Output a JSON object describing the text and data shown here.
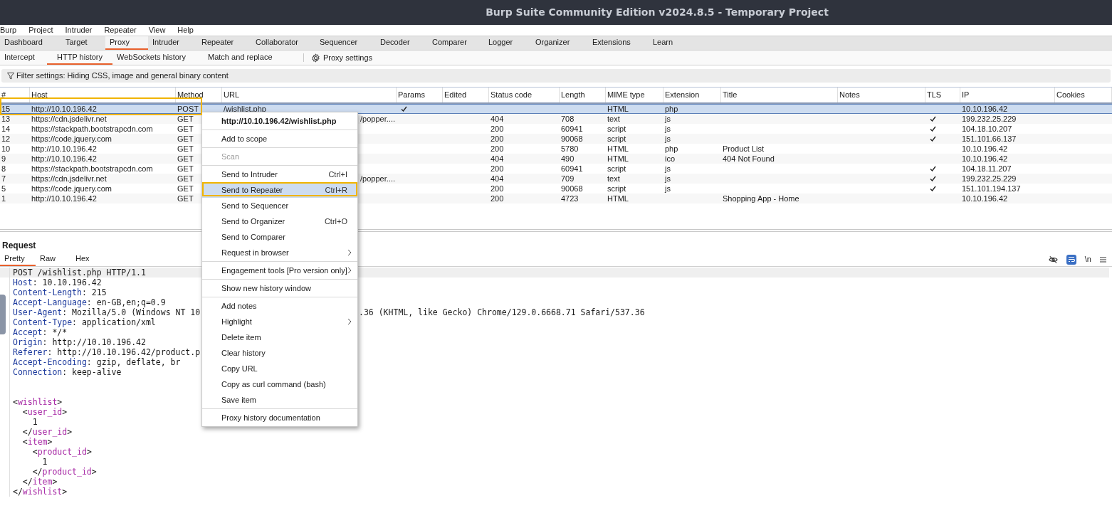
{
  "window": {
    "title": "Burp Suite Community Edition v2024.8.5 - Temporary Project"
  },
  "menu_bar": [
    "Burp",
    "Project",
    "Intruder",
    "Repeater",
    "View",
    "Help"
  ],
  "tabs": [
    {
      "label": "Dashboard",
      "selected": false
    },
    {
      "label": "Target",
      "selected": false
    },
    {
      "label": "Proxy",
      "selected": true
    },
    {
      "label": "Intruder",
      "selected": false
    },
    {
      "label": "Repeater",
      "selected": false
    },
    {
      "label": "Collaborator",
      "selected": false
    },
    {
      "label": "Sequencer",
      "selected": false
    },
    {
      "label": "Decoder",
      "selected": false
    },
    {
      "label": "Comparer",
      "selected": false
    },
    {
      "label": "Logger",
      "selected": false
    },
    {
      "label": "Organizer",
      "selected": false
    },
    {
      "label": "Extensions",
      "selected": false
    },
    {
      "label": "Learn",
      "selected": false
    }
  ],
  "sub_tabs": [
    {
      "label": "Intercept",
      "selected": false
    },
    {
      "label": "HTTP history",
      "selected": true
    },
    {
      "label": "WebSockets history",
      "selected": false
    },
    {
      "label": "Match and replace",
      "selected": false
    }
  ],
  "proxy_settings": "Proxy settings",
  "filter": "Filter settings: Hiding CSS, image and general binary content",
  "table": {
    "columns": [
      "#",
      "Host",
      "Method",
      "URL",
      "Params",
      "Edited",
      "Status code",
      "Length",
      "MIME type",
      "Extension",
      "Title",
      "Notes",
      "TLS",
      "IP",
      "Cookies"
    ],
    "rows": [
      {
        "num": "15",
        "host": "http://10.10.196.42",
        "method": "POST",
        "url": "/wishlist.php",
        "params": true,
        "status": "",
        "length": "",
        "mime": "HTML",
        "ext": "php",
        "title": "",
        "tls": false,
        "ip": "10.10.196.42",
        "selected": true
      },
      {
        "num": "13",
        "host": "https://cdn.jsdelivr.net",
        "method": "GET",
        "url_tail": "/popper....",
        "params": false,
        "status": "404",
        "length": "708",
        "mime": "text",
        "ext": "js",
        "title": "",
        "tls": true,
        "ip": "199.232.25.229",
        "selected": false
      },
      {
        "num": "14",
        "host": "https://stackpath.bootstrapcdn.com",
        "method": "GET",
        "params": false,
        "status": "200",
        "length": "60941",
        "mime": "script",
        "ext": "js",
        "title": "",
        "tls": true,
        "ip": "104.18.10.207",
        "selected": false
      },
      {
        "num": "12",
        "host": "https://code.jquery.com",
        "method": "GET",
        "params": false,
        "status": "200",
        "length": "90068",
        "mime": "script",
        "ext": "js",
        "title": "",
        "tls": true,
        "ip": "151.101.66.137",
        "selected": false
      },
      {
        "num": "10",
        "host": "http://10.10.196.42",
        "method": "GET",
        "params": false,
        "status": "200",
        "length": "5780",
        "mime": "HTML",
        "ext": "php",
        "title": "Product List",
        "tls": false,
        "ip": "10.10.196.42",
        "selected": false
      },
      {
        "num": "9",
        "host": "http://10.10.196.42",
        "method": "GET",
        "params": false,
        "status": "404",
        "length": "490",
        "mime": "HTML",
        "ext": "ico",
        "title": "404 Not Found",
        "tls": false,
        "ip": "10.10.196.42",
        "selected": false
      },
      {
        "num": "8",
        "host": "https://stackpath.bootstrapcdn.com",
        "method": "GET",
        "params": false,
        "status": "200",
        "length": "60941",
        "mime": "script",
        "ext": "js",
        "title": "",
        "tls": true,
        "ip": "104.18.11.207",
        "selected": false
      },
      {
        "num": "7",
        "host": "https://cdn.jsdelivr.net",
        "method": "GET",
        "url_tail": "/popper....",
        "params": false,
        "status": "404",
        "length": "709",
        "mime": "text",
        "ext": "js",
        "title": "",
        "tls": true,
        "ip": "199.232.25.229",
        "selected": false
      },
      {
        "num": "5",
        "host": "https://code.jquery.com",
        "method": "GET",
        "params": false,
        "status": "200",
        "length": "90068",
        "mime": "script",
        "ext": "js",
        "title": "",
        "tls": true,
        "ip": "151.101.194.137",
        "selected": false
      },
      {
        "num": "1",
        "host": "http://10.10.196.42",
        "method": "GET",
        "params": false,
        "status": "200",
        "length": "4723",
        "mime": "HTML",
        "ext": "",
        "title": "Shopping App - Home",
        "tls": false,
        "ip": "10.10.196.42",
        "selected": false
      }
    ]
  },
  "request": {
    "heading": "Request",
    "tabs": [
      {
        "label": "Pretty",
        "selected": true
      },
      {
        "label": "Raw",
        "selected": false
      },
      {
        "label": "Hex",
        "selected": false
      }
    ],
    "newline_toggle": "\\n",
    "wrap_on": true,
    "lines": [
      {
        "kind": "plain",
        "text": "POST /wishlist.php HTTP/1.1"
      },
      {
        "kind": "header",
        "name": "Host",
        "value": ": 10.10.196.42"
      },
      {
        "kind": "header",
        "name": "Content-Length",
        "value": ": 215"
      },
      {
        "kind": "header",
        "name": "Accept-Language",
        "value": ": en-GB,en;q=0.9"
      },
      {
        "kind": "header",
        "name": "User-Agent",
        "value": ": Mozilla/5.0 (Windows NT 10",
        "tail": ".36 (KHTML, like Gecko) Chrome/129.0.6668.71 Safari/537.36"
      },
      {
        "kind": "header",
        "name": "Content-Type",
        "value": ": application/xml"
      },
      {
        "kind": "header",
        "name": "Accept",
        "value": ": */*"
      },
      {
        "kind": "header",
        "name": "Origin",
        "value": ": http://10.10.196.42"
      },
      {
        "kind": "header",
        "name": "Referer",
        "value": ": http://10.10.196.42/product.p"
      },
      {
        "kind": "header",
        "name": "Accept-Encoding",
        "value": ": gzip, deflate, br"
      },
      {
        "kind": "header",
        "name": "Connection",
        "value": ": keep-alive"
      },
      {
        "kind": "blank"
      },
      {
        "kind": "blank"
      },
      {
        "kind": "tag",
        "open": "<",
        "tag": "wishlist",
        "close": ">"
      },
      {
        "kind": "tag",
        "open": "  <",
        "tag": "user_id",
        "close": ">"
      },
      {
        "kind": "plain",
        "text": "    1"
      },
      {
        "kind": "tag",
        "open": "  </",
        "tag": "user_id",
        "close": ">"
      },
      {
        "kind": "tag",
        "open": "  <",
        "tag": "item",
        "close": ">"
      },
      {
        "kind": "tag",
        "open": "    <",
        "tag": "product_id",
        "close": ">"
      },
      {
        "kind": "plain",
        "text": "      1"
      },
      {
        "kind": "tag",
        "open": "    </",
        "tag": "product_id",
        "close": ">"
      },
      {
        "kind": "tag",
        "open": "  </",
        "tag": "item",
        "close": ">"
      },
      {
        "kind": "tag",
        "open": "</",
        "tag": "wishlist",
        "close": ">"
      }
    ]
  },
  "context_menu": {
    "title": "http://10.10.196.42/wishlist.php",
    "groups": [
      [
        {
          "label": "Add to scope",
          "disabled": false,
          "selected": false
        }
      ],
      [
        {
          "label": "Scan",
          "disabled": true,
          "selected": false
        }
      ],
      [
        {
          "label": "Send to Intruder",
          "shortcut": "Ctrl+I",
          "disabled": false,
          "selected": false
        },
        {
          "label": "Send to Repeater",
          "shortcut": "Ctrl+R",
          "disabled": false,
          "selected": true
        },
        {
          "label": "Send to Sequencer",
          "disabled": false,
          "selected": false
        },
        {
          "label": "Send to Organizer",
          "shortcut": "Ctrl+O",
          "disabled": false,
          "selected": false
        },
        {
          "label": "Send to Comparer",
          "disabled": false,
          "selected": false
        },
        {
          "label": "Request in browser",
          "submenu": true,
          "disabled": false,
          "selected": false
        }
      ],
      [
        {
          "label": "Engagement tools [Pro version only]",
          "submenu": true,
          "disabled": false,
          "selected": false
        }
      ],
      [
        {
          "label": "Show new history window",
          "disabled": false,
          "selected": false
        }
      ],
      [
        {
          "label": "Add notes",
          "disabled": false,
          "selected": false
        },
        {
          "label": "Highlight",
          "submenu": true,
          "disabled": false,
          "selected": false
        },
        {
          "label": "Delete item",
          "disabled": false,
          "selected": false
        },
        {
          "label": "Clear history",
          "disabled": false,
          "selected": false
        },
        {
          "label": "Copy URL",
          "disabled": false,
          "selected": false
        },
        {
          "label": "Copy as curl command (bash)",
          "disabled": false,
          "selected": false
        },
        {
          "label": "Save item",
          "disabled": false,
          "selected": false
        }
      ],
      [
        {
          "label": "Proxy history documentation",
          "disabled": false,
          "selected": false
        }
      ]
    ]
  }
}
